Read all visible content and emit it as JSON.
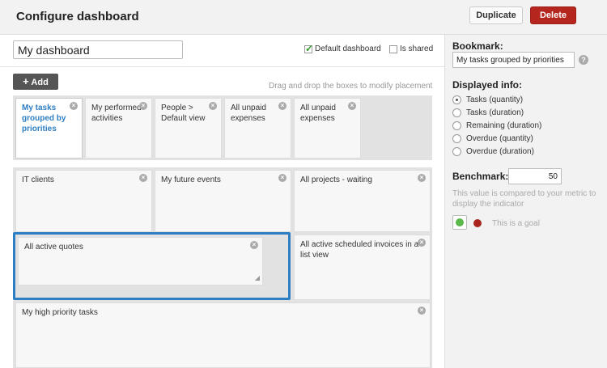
{
  "header": {
    "title": "Configure dashboard",
    "duplicate_label": "Duplicate",
    "delete_label": "Delete"
  },
  "form": {
    "dashboard_name": "My dashboard",
    "default_dashboard_label": "Default dashboard",
    "default_dashboard_checked": true,
    "is_shared_label": "Is shared",
    "is_shared_checked": false
  },
  "toolbar": {
    "add_label": "Add",
    "add_icon": "plus-icon",
    "hint": "Drag and drop the boxes to modify placement"
  },
  "top_boxes": [
    {
      "label": "My tasks grouped by priorities",
      "selected": true
    },
    {
      "label": "My performed activities"
    },
    {
      "label": "People > Default view"
    },
    {
      "label": "All unpaid expenses"
    },
    {
      "label": "All unpaid expenses"
    }
  ],
  "grid_boxes": [
    {
      "label": "IT clients"
    },
    {
      "label": "My future events"
    },
    {
      "label": "All projects - waiting"
    },
    {
      "label": "All active quotes"
    },
    {
      "label": "All active scheduled invoices in a list view"
    },
    {
      "label": "My high priority tasks"
    }
  ],
  "panel": {
    "bookmark_label": "Bookmark:",
    "bookmark_value": "My tasks grouped by priorities",
    "help_icon": "?",
    "displayed_info_label": "Displayed info:",
    "options": [
      {
        "label": "Tasks (quantity)",
        "selected": true
      },
      {
        "label": "Tasks (duration)"
      },
      {
        "label": "Remaining (duration)"
      },
      {
        "label": "Overdue (quantity)"
      },
      {
        "label": "Overdue (duration)"
      }
    ],
    "benchmark_label": "Benchmark:",
    "benchmark_value": "50",
    "benchmark_desc": "This value is compared to your metric to display the indicator",
    "goal_text": "This is a goal",
    "goal_selected": "green"
  },
  "colors": {
    "accent_blue": "#2e7ec3",
    "delete_red": "#b5271e",
    "goal_green": "#5cb84a",
    "goal_red": "#a8241d"
  }
}
